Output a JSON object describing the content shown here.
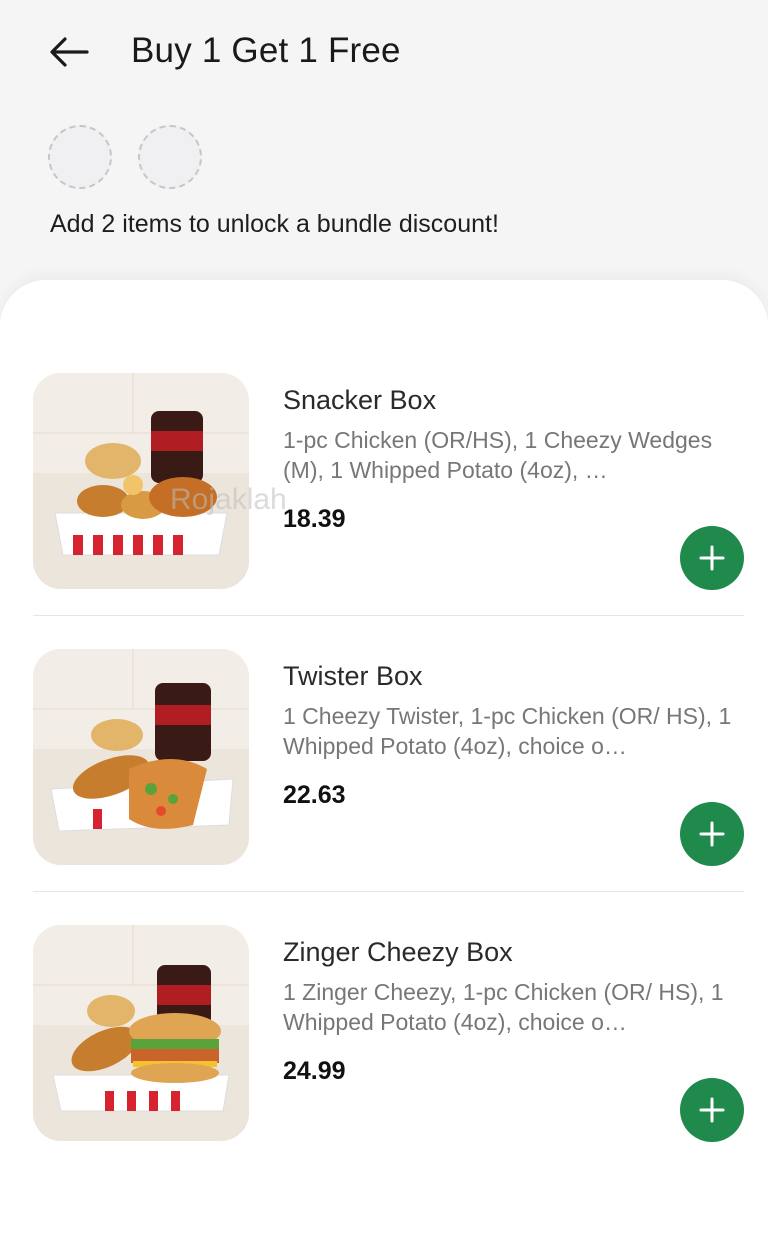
{
  "header": {
    "back_icon": "arrow-left-icon",
    "title": "Buy 1 Get 1 Free"
  },
  "bundle": {
    "slot_count": 2,
    "hint": "Add 2 items to unlock a bundle discount!"
  },
  "watermark": "Rojaklah",
  "items": [
    {
      "name": "Snacker Box",
      "description": "1-pc Chicken (OR/HS), 1 Cheezy Wedges (M), 1 Whipped Potato (4oz), …",
      "price": "18.39",
      "add_icon": "plus-icon"
    },
    {
      "name": "Twister Box",
      "description": "1 Cheezy Twister, 1-pc Chicken (OR/ HS), 1 Whipped Potato (4oz), choice o…",
      "price": "22.63",
      "add_icon": "plus-icon"
    },
    {
      "name": "Zinger Cheezy Box",
      "description": "1 Zinger Cheezy, 1-pc Chicken (OR/ HS), 1 Whipped Potato (4oz), choice o…",
      "price": "24.99",
      "add_icon": "plus-icon"
    }
  ],
  "colors": {
    "accent": "#1f8a4c",
    "background": "#f5f5f5",
    "sheet": "#ffffff",
    "kfc_red": "#d6232f"
  }
}
